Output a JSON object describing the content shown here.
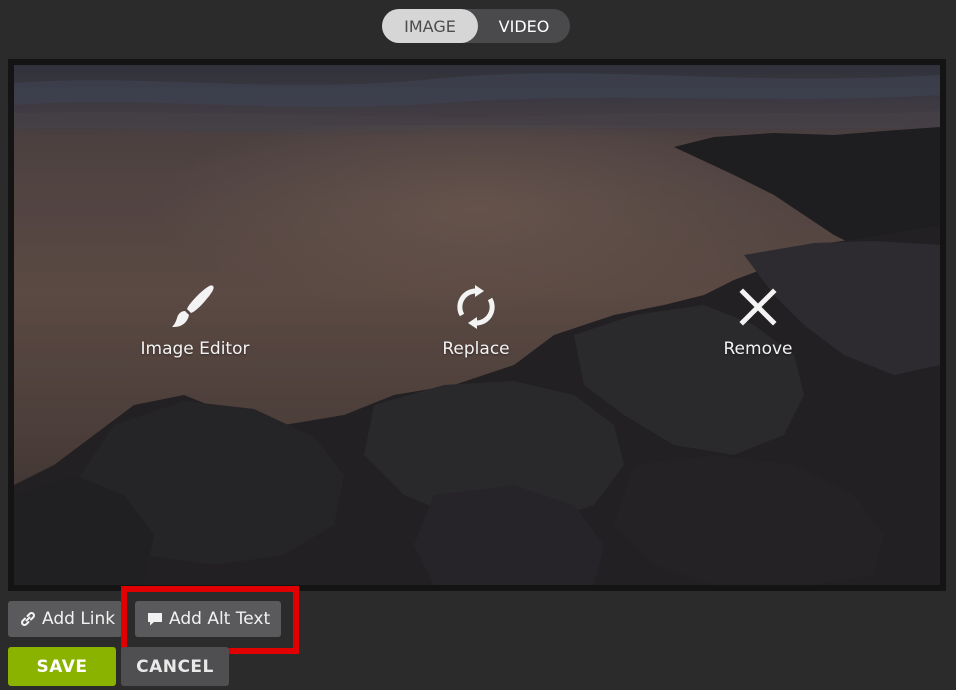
{
  "tabs": {
    "image": "IMAGE",
    "video": "VIDEO",
    "active": "IMAGE"
  },
  "image_actions": {
    "editor": {
      "label": "Image Editor",
      "icon": "paintbrush-icon"
    },
    "replace": {
      "label": "Replace",
      "icon": "refresh-icon"
    },
    "remove": {
      "label": "Remove",
      "icon": "close-icon"
    }
  },
  "bottom_actions": {
    "add_link": {
      "label": "Add Link",
      "icon": "link-icon"
    },
    "add_alt_text": {
      "label": "Add Alt Text",
      "icon": "comment-icon"
    },
    "save": "SAVE",
    "cancel": "CANCEL"
  },
  "colors": {
    "save_green": "#8ab300",
    "highlight_red": "#e00000",
    "background": "#2b2b2c"
  }
}
